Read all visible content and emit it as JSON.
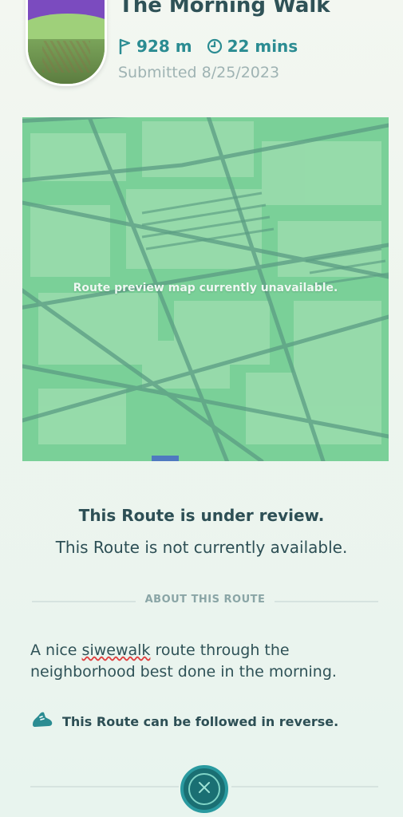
{
  "header": {
    "title": "The Morning Walk",
    "distance": "928 m",
    "duration": "22 mins",
    "submitted": "Submitted 8/25/2023"
  },
  "map": {
    "unavailable_text": "Route preview map currently unavailable."
  },
  "status": {
    "title": "This Route is under review.",
    "subtitle": "This Route is not currently available."
  },
  "about": {
    "section_label": "ABOUT THIS ROUTE",
    "description_prefix": "A nice ",
    "misspelled_word": "siwewalk",
    "description_suffix": " route through the neighborhood best done in the morning."
  },
  "reverse": {
    "text": "This Route can be followed in reverse."
  },
  "icons": {
    "distance": "flag-icon",
    "duration": "clock-icon",
    "reverse": "shoe-icon",
    "close": "close-icon"
  },
  "colors": {
    "accent": "#2b8c92",
    "close_button": "#1a6f73"
  }
}
